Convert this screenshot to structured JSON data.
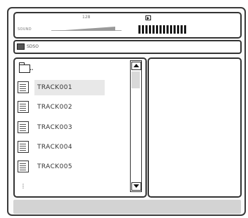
{
  "status": {
    "track_number": "128",
    "volume_label": "SOUND",
    "level_bar_count": 14,
    "play_icon": "play-icon"
  },
  "path": {
    "icon": "folder-icon",
    "text": "SDSO"
  },
  "file_list": {
    "parent": {
      "icon": "folder-up-icon",
      "label": ".."
    },
    "items": [
      {
        "icon": "document-icon",
        "label": "TRACK001",
        "selected": true
      },
      {
        "icon": "document-icon",
        "label": "TRACK002",
        "selected": false
      },
      {
        "icon": "document-icon",
        "label": "TRACK003",
        "selected": false
      },
      {
        "icon": "document-icon",
        "label": "TRACK004",
        "selected": false
      },
      {
        "icon": "document-icon",
        "label": "TRACK005",
        "selected": false
      }
    ],
    "more_indicator": "⋮"
  },
  "scrollbar": {
    "up_icon": "arrow-up-icon",
    "down_icon": "arrow-down-icon"
  },
  "colors": {
    "border": "#333333",
    "selection": "#e8e8e8",
    "bottom_bar": "#d3d3d3"
  }
}
